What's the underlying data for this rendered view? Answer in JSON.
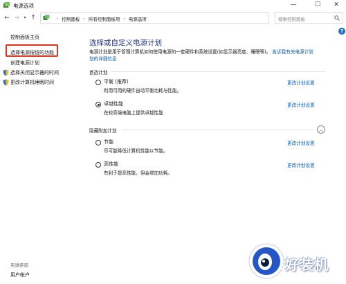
{
  "window": {
    "title": "电源选项"
  },
  "address": {
    "crumbs": [
      "控制面板",
      "所有控制面板项",
      "电源选项"
    ]
  },
  "search": {
    "placeholder": "搜索控制面板"
  },
  "sidebar": {
    "items": [
      {
        "label": "控制面板主页"
      },
      {
        "label": "选择电源按钮的功能"
      },
      {
        "label": "创建电源计划"
      },
      {
        "label": "选择关闭显示器的时间"
      },
      {
        "label": "更改计算机睡眠时间"
      }
    ],
    "see_also": "另请参阅",
    "user_accounts": "用户帐户"
  },
  "main": {
    "title": "选择或自定义电源计划",
    "intro_text": "电源计划是用于管理计算机如何使用电源的一套硬件和系统设置(如显示器亮度、睡眠等)。",
    "intro_link_1": "告诉我有关电源计划",
    "intro_link_2": "划的详细信息",
    "preferred_label": "首选计划",
    "hidden_label": "隐藏附加计划",
    "plans": [
      {
        "name": "平衡 (推荐)",
        "desc": "利用可用的硬件自动平衡功耗与性能。",
        "link": "更改计划设置",
        "selected": false
      },
      {
        "name": "卓越性能",
        "desc": "在较高端电脑上提供卓越性能",
        "link": "更改计划设置",
        "selected": true
      },
      {
        "name": "节能",
        "desc": "尽可能降低计算机性能以节能。",
        "link": "更改计划设置",
        "selected": false
      },
      {
        "name": "高性能",
        "desc": "有利于提高性能，但会增加功耗。",
        "link": "更改计划设置",
        "selected": false
      }
    ]
  },
  "watermark": {
    "text": "好装机"
  },
  "colors": {
    "accent": "#1e3287",
    "link": "#0a5bb5",
    "highlight": "#e0301e"
  }
}
